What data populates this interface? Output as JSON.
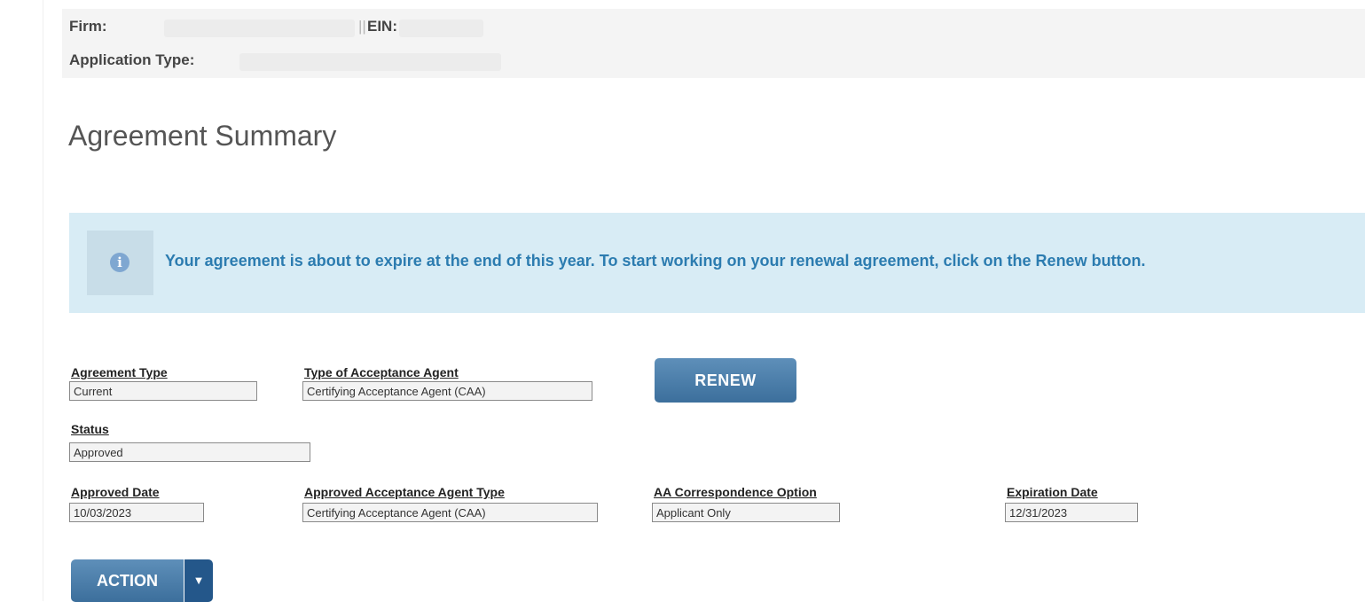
{
  "header": {
    "firm_label": "Firm:",
    "ein_label": "EIN:",
    "application_type_label": "Application Type:"
  },
  "page_title": "Agreement Summary",
  "alert": {
    "icon": "info-icon",
    "message": "Your agreement is about to expire at the end of this year. To start working on your renewal agreement, click on the Renew button."
  },
  "fields": {
    "agreement_type": {
      "label": "Agreement Type",
      "value": "Current"
    },
    "acceptance_agent_type": {
      "label": "Type of Acceptance Agent",
      "value": "Certifying Acceptance Agent (CAA)"
    },
    "status": {
      "label": "Status",
      "value": "Approved"
    },
    "approved_date": {
      "label": "Approved Date",
      "value": "10/03/2023"
    },
    "approved_agent_type": {
      "label": "Approved Acceptance Agent Type",
      "value": "Certifying Acceptance Agent (CAA)"
    },
    "correspondence_option": {
      "label": "AA Correspondence Option",
      "value": "Applicant Only"
    },
    "expiration_date": {
      "label": "Expiration Date",
      "value": "12/31/2023"
    }
  },
  "buttons": {
    "renew_label": "RENEW",
    "action_label": "ACTION",
    "action_caret_icon": "caret-down-icon"
  },
  "colors": {
    "alert_background": "#d8ecf5",
    "alert_text": "#2c7cb0",
    "button_primary": "#4a7eab",
    "button_dark": "#24578a"
  }
}
